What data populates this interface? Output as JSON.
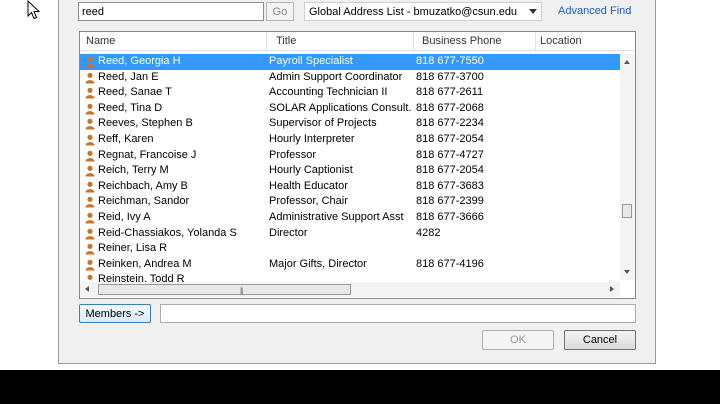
{
  "search": {
    "value": "reed",
    "go_label": "Go"
  },
  "address_book": {
    "selected": "Global Address List - bmuzatko@csun.edu",
    "advanced_find": "Advanced Find"
  },
  "columns": {
    "name": "Name",
    "title": "Title",
    "business_phone": "Business Phone",
    "location": "Location"
  },
  "rows": [
    {
      "name": "Reed, Georgia H",
      "title": "Payroll Specialist",
      "phone": "818 677-7550"
    },
    {
      "name": "Reed, Jan E",
      "title": "Admin Support Coordinator",
      "phone": "818 677-3700"
    },
    {
      "name": "Reed, Sanae T",
      "title": "Accounting Technician II",
      "phone": "818 677-2611"
    },
    {
      "name": "Reed, Tina D",
      "title": "SOLAR Applications Consult...",
      "phone": "818 677-2068"
    },
    {
      "name": "Reeves, Stephen B",
      "title": "Supervisor of Projects",
      "phone": "818 677-2234"
    },
    {
      "name": "Reff, Karen",
      "title": "Hourly Interpreter",
      "phone": "818 677-2054"
    },
    {
      "name": "Regnat, Francoise J",
      "title": "Professor",
      "phone": "818 677-4727"
    },
    {
      "name": "Reich, Terry M",
      "title": "Hourly Captionist",
      "phone": "818 677-2054"
    },
    {
      "name": "Reichbach, Amy B",
      "title": "Health Educator",
      "phone": "818 677-3683"
    },
    {
      "name": "Reichman, Sandor",
      "title": "Professor, Chair",
      "phone": "818 677-2399"
    },
    {
      "name": "Reid, Ivy A",
      "title": "Administrative Support Asst",
      "phone": "818 677-3666"
    },
    {
      "name": "Reid-Chassiakos, Yolanda S",
      "title": "Director",
      "phone": "4282"
    },
    {
      "name": "Reiner, Lisa R",
      "title": "",
      "phone": ""
    },
    {
      "name": "Reinken, Andrea M",
      "title": "Major Gifts, Director",
      "phone": "818 677-4196"
    },
    {
      "name": "Reinstein, Todd R",
      "title": "",
      "phone": ""
    }
  ],
  "selected_row": 0,
  "members_label": "Members ->",
  "members_value": "",
  "ok_label": "OK",
  "cancel_label": "Cancel",
  "colors": {
    "selection": "#3399ff",
    "link": "#1f5fbf",
    "contact_icon": "#c8752a"
  },
  "icons": {
    "contact": "contact-person-icon",
    "cursor": "mouse-pointer-icon"
  }
}
